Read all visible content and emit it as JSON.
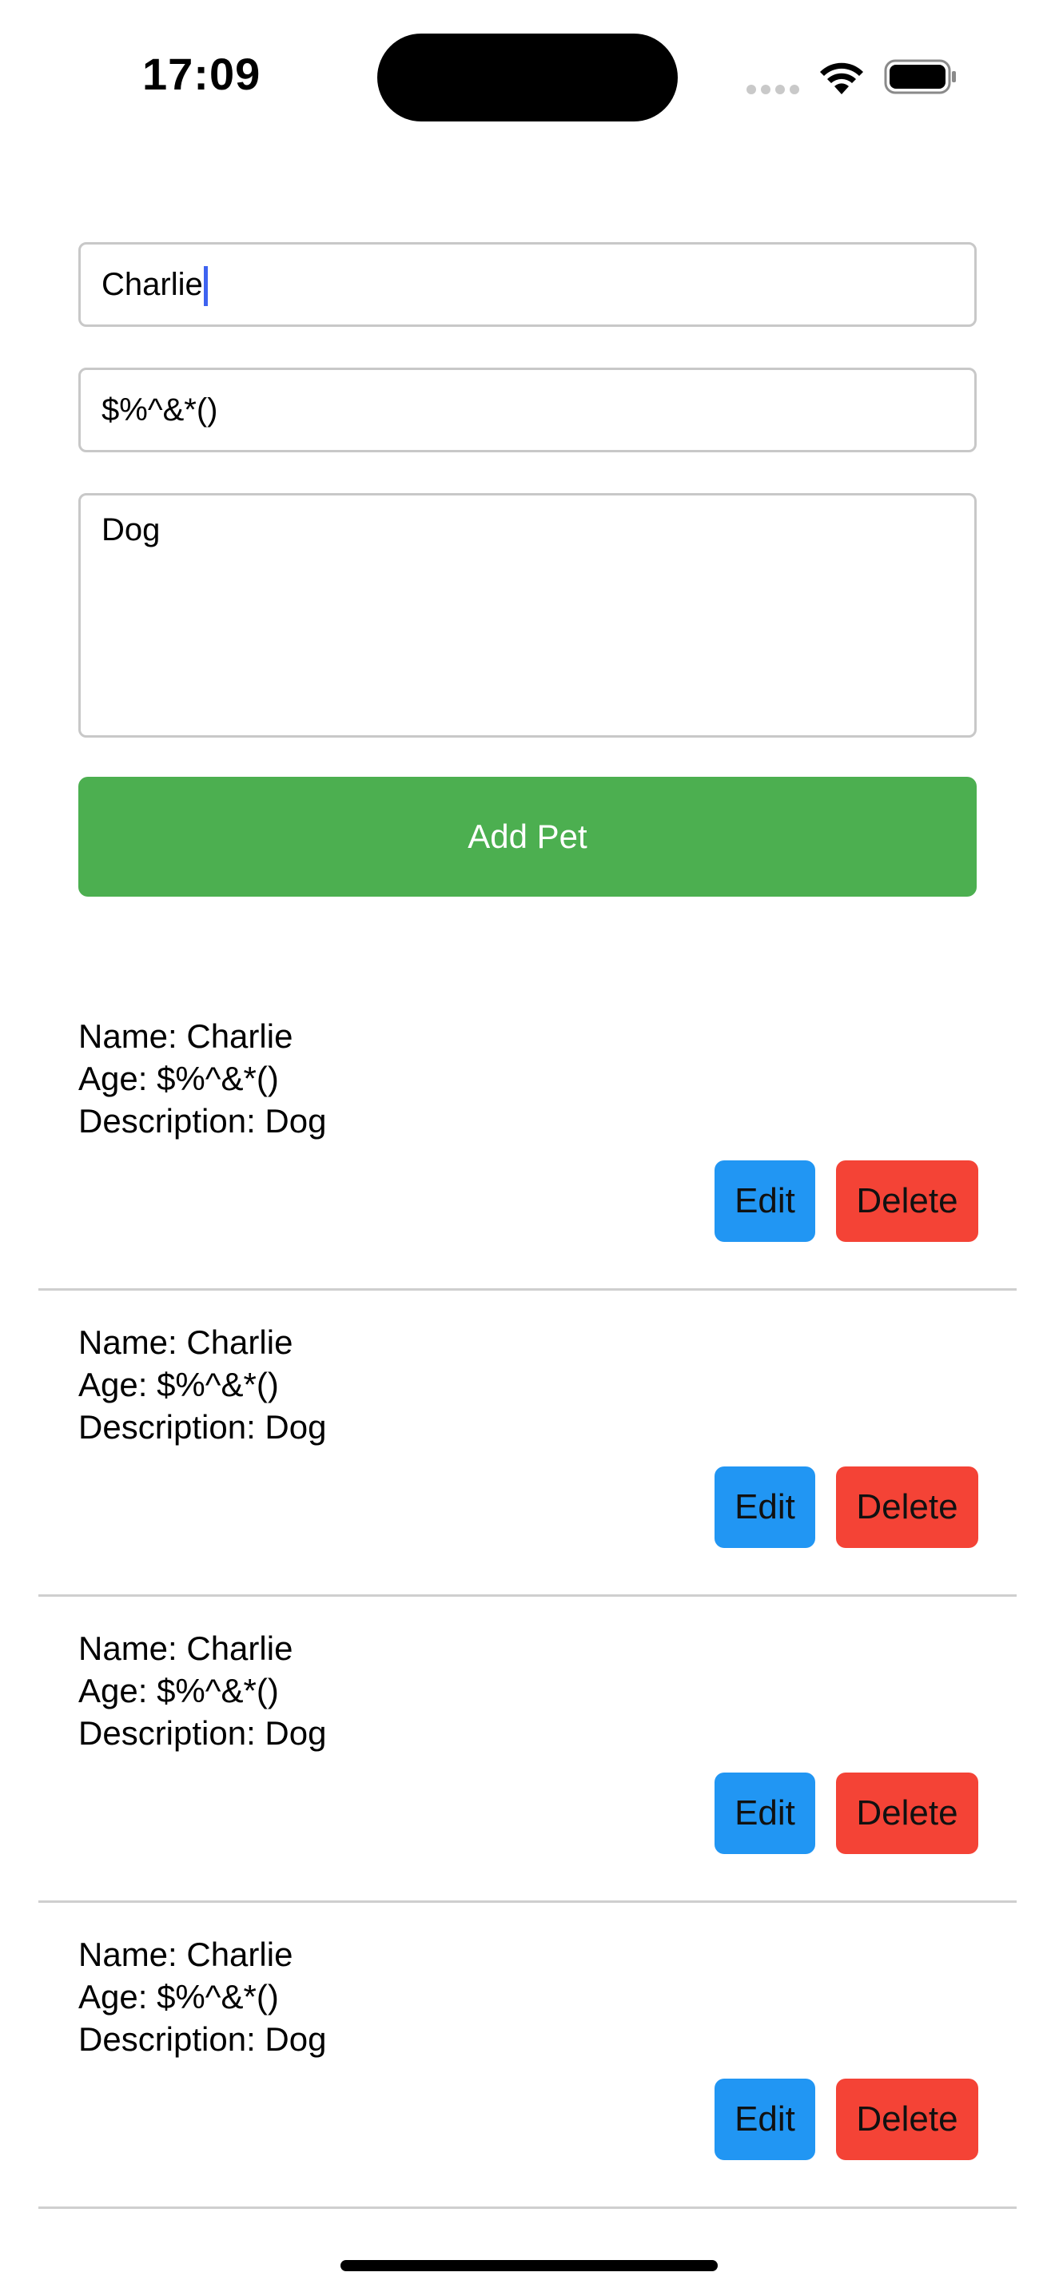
{
  "status_bar": {
    "time": "17:09"
  },
  "form": {
    "name_value": "Charlie",
    "age_value": "$%^&*()",
    "description_value": "Dog",
    "add_button_label": "Add Pet"
  },
  "pets": [
    {
      "name": "Name: Charlie",
      "age": "Age: $%^&*()",
      "description": "Description: Dog",
      "edit": "Edit",
      "delete": "Delete"
    },
    {
      "name": "Name: Charlie",
      "age": "Age: $%^&*()",
      "description": "Description: Dog",
      "edit": "Edit",
      "delete": "Delete"
    },
    {
      "name": "Name: Charlie",
      "age": "Age: $%^&*()",
      "description": "Description: Dog",
      "edit": "Edit",
      "delete": "Delete"
    },
    {
      "name": "Name: Charlie",
      "age": "Age: $%^&*()",
      "description": "Description: Dog",
      "edit": "Edit",
      "delete": "Delete"
    }
  ],
  "colors": {
    "add_button": "#4caf50",
    "edit_button": "#2196f3",
    "delete_button": "#f44336",
    "caret": "#3e63f0"
  },
  "icons": [
    "wifi-icon",
    "battery-icon",
    "cellular-signal-icon"
  ]
}
